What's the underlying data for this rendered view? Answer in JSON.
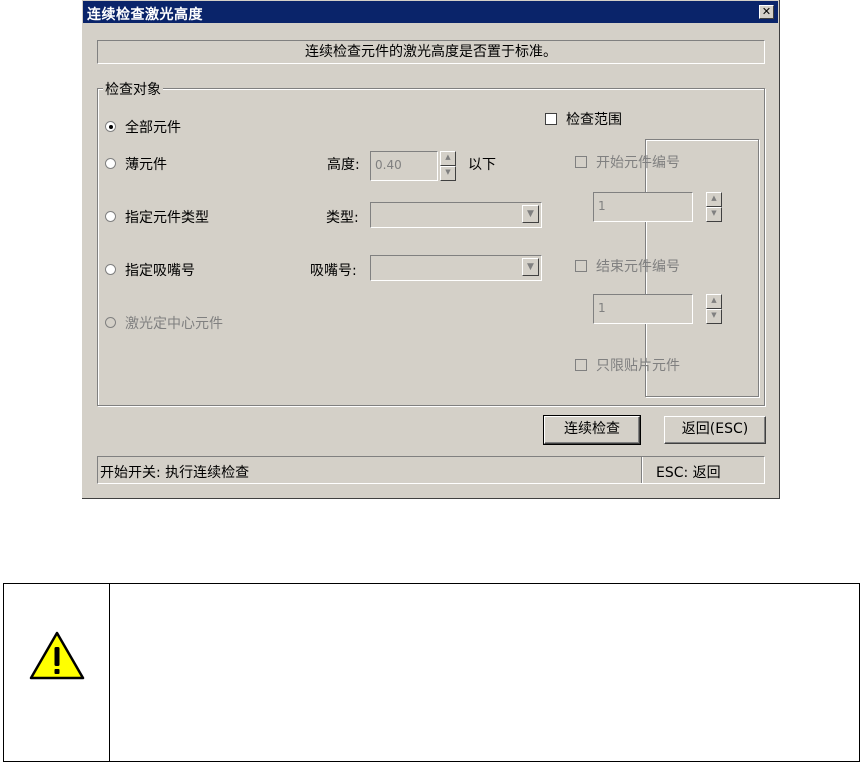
{
  "dialog": {
    "title": "连续检查激光高度",
    "close_label": "✕",
    "message": "连续检查元件的激光高度是否置于标准。",
    "group_label": "检查对象",
    "options": [
      {
        "label": "全部元件",
        "selected": true,
        "enabled": true
      },
      {
        "label": "薄元件",
        "selected": false,
        "enabled": true
      },
      {
        "label": "指定元件类型",
        "selected": false,
        "enabled": true
      },
      {
        "label": "指定吸嘴号",
        "selected": false,
        "enabled": true
      },
      {
        "label": "激光定中心元件",
        "selected": false,
        "enabled": false
      }
    ],
    "height": {
      "label": "高度:",
      "value": "0.40",
      "suffix": "以下"
    },
    "type": {
      "label": "类型:",
      "value": ""
    },
    "nozzle": {
      "label": "吸嘴号:",
      "value": ""
    },
    "range": {
      "label": "检查范围",
      "start": {
        "label": "开始元件编号",
        "value": "1"
      },
      "end": {
        "label": "结束元件编号",
        "value": "1"
      },
      "chip_only": {
        "label": "只限贴片元件"
      }
    },
    "buttons": {
      "continue": "连续检查",
      "back": "返回(ESC)"
    },
    "status": {
      "left": "开始开关: 执行连续检查",
      "right": "ESC: 返回"
    }
  },
  "colors": {
    "titlebar": "#0a246a",
    "dialog_bg": "#d4d0c8",
    "disabled_text": "#808080",
    "warning_yellow": "#ffff00"
  },
  "warning": {
    "icon": "warning-triangle-icon"
  }
}
